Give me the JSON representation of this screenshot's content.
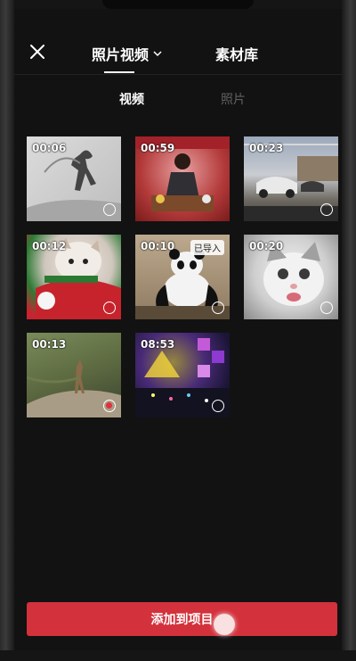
{
  "header": {
    "tab_main": "照片视频",
    "tab_library": "素材库"
  },
  "subtabs": {
    "video": "视频",
    "photo": "照片"
  },
  "media": [
    {
      "duration": "00:06",
      "selected": false,
      "imported": false
    },
    {
      "duration": "00:59",
      "selected": false,
      "imported": false
    },
    {
      "duration": "00:23",
      "selected": false,
      "imported": false
    },
    {
      "duration": "00:12",
      "selected": false,
      "imported": false
    },
    {
      "duration": "00:10",
      "selected": false,
      "imported": true,
      "badge": "已导入"
    },
    {
      "duration": "00:20",
      "selected": false,
      "imported": false
    },
    {
      "duration": "00:13",
      "selected": true,
      "imported": false
    },
    {
      "duration": "08:53",
      "selected": false,
      "imported": false
    }
  ],
  "footer": {
    "add_label": "添加到项目"
  },
  "colors": {
    "accent": "#d3313b",
    "background": "#121212"
  }
}
